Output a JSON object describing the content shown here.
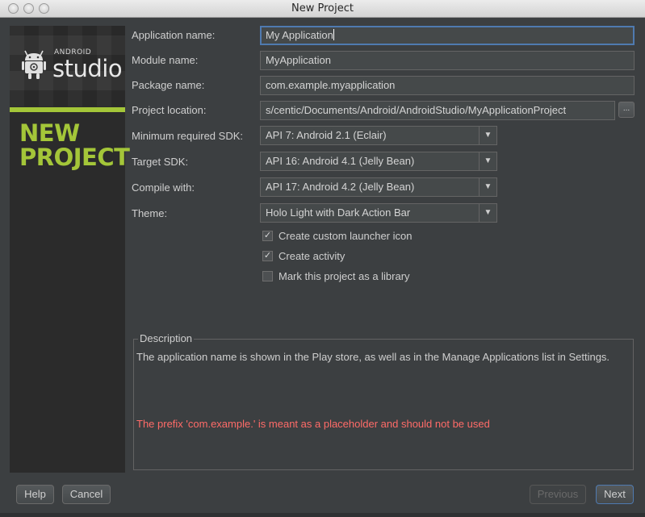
{
  "window": {
    "title": "New Project"
  },
  "banner": {
    "logo_small": "ANDROID",
    "logo_big": "studio",
    "heading_line1": "NEW",
    "heading_line2": "PROJECT"
  },
  "form": {
    "app_name_label": "Application name:",
    "app_name_value": "My Application",
    "module_name_label": "Module name:",
    "module_name_value": "MyApplication",
    "package_name_label": "Package name:",
    "package_name_value": "com.example.myapplication",
    "project_location_label": "Project location:",
    "project_location_value": "s/centic/Documents/Android/AndroidStudio/MyApplicationProject",
    "browse_label": "...",
    "min_sdk_label": "Minimum required SDK:",
    "min_sdk_value": "API 7: Android 2.1 (Eclair)",
    "target_sdk_label": "Target SDK:",
    "target_sdk_value": "API 16: Android 4.1 (Jelly Bean)",
    "compile_with_label": "Compile with:",
    "compile_with_value": "API 17: Android 4.2 (Jelly Bean)",
    "theme_label": "Theme:",
    "theme_value": "Holo Light with Dark Action Bar",
    "checkboxes": [
      {
        "label": "Create custom launcher icon",
        "checked": true
      },
      {
        "label": "Create activity",
        "checked": true
      },
      {
        "label": "Mark this project as a library",
        "checked": false
      }
    ]
  },
  "description": {
    "title": "Description",
    "text": "The application name is shown in the Play store, as well as in the Manage Applications list in Settings.",
    "warning": "The prefix 'com.example.' is meant as a placeholder and should not be used",
    "warning_color": "#ff6b68"
  },
  "buttons": {
    "help": "Help",
    "cancel": "Cancel",
    "previous": "Previous",
    "next": "Next"
  },
  "colors": {
    "accent_green": "#a4c639",
    "focus_blue": "#4f7ab0"
  }
}
